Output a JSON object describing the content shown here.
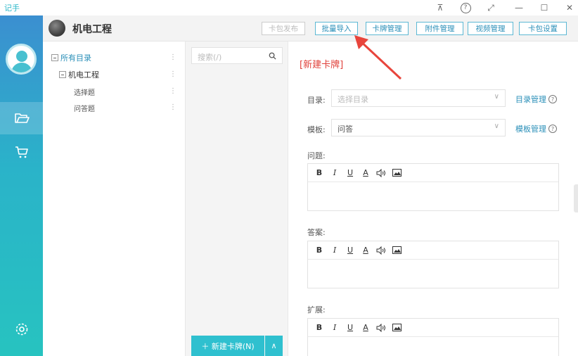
{
  "app": {
    "title": "记手"
  },
  "window_controls": {
    "pin": "⊼",
    "help": "?",
    "expand": "⤢",
    "minimize": "—",
    "maximize": "☐",
    "close": "✕"
  },
  "header": {
    "title": "机电工程",
    "buttons": {
      "publish": "卡包发布",
      "batch_import": "批量导入",
      "card_manage": "卡牌管理",
      "attachment_manage": "附件管理",
      "video_manage": "视频管理",
      "pack_settings": "卡包设置"
    }
  },
  "tree": {
    "root": "所有目录",
    "node": "机电工程",
    "children": [
      "选择题",
      "问答题"
    ],
    "dots": "⋮"
  },
  "list": {
    "search_placeholder": "搜索(/)",
    "new_card": "＋ 新建卡牌(N)",
    "arrow": "∧"
  },
  "form": {
    "title": "[新建卡牌]",
    "directory_label": "目录:",
    "directory_placeholder": "选择目录",
    "directory_link": "目录管理",
    "template_label": "模板:",
    "template_value": "问答",
    "template_link": "模板管理",
    "question_label": "问题:",
    "answer_label": "答案:",
    "extend_label": "扩展:",
    "chevron": "∨",
    "help": "?"
  },
  "toolbar": {
    "bold": "B",
    "italic": "I",
    "underline": "U",
    "color": "A"
  },
  "colors": {
    "accent": "#2fc0cf",
    "link": "#2a8fb8",
    "title_red": "#e0403a"
  }
}
